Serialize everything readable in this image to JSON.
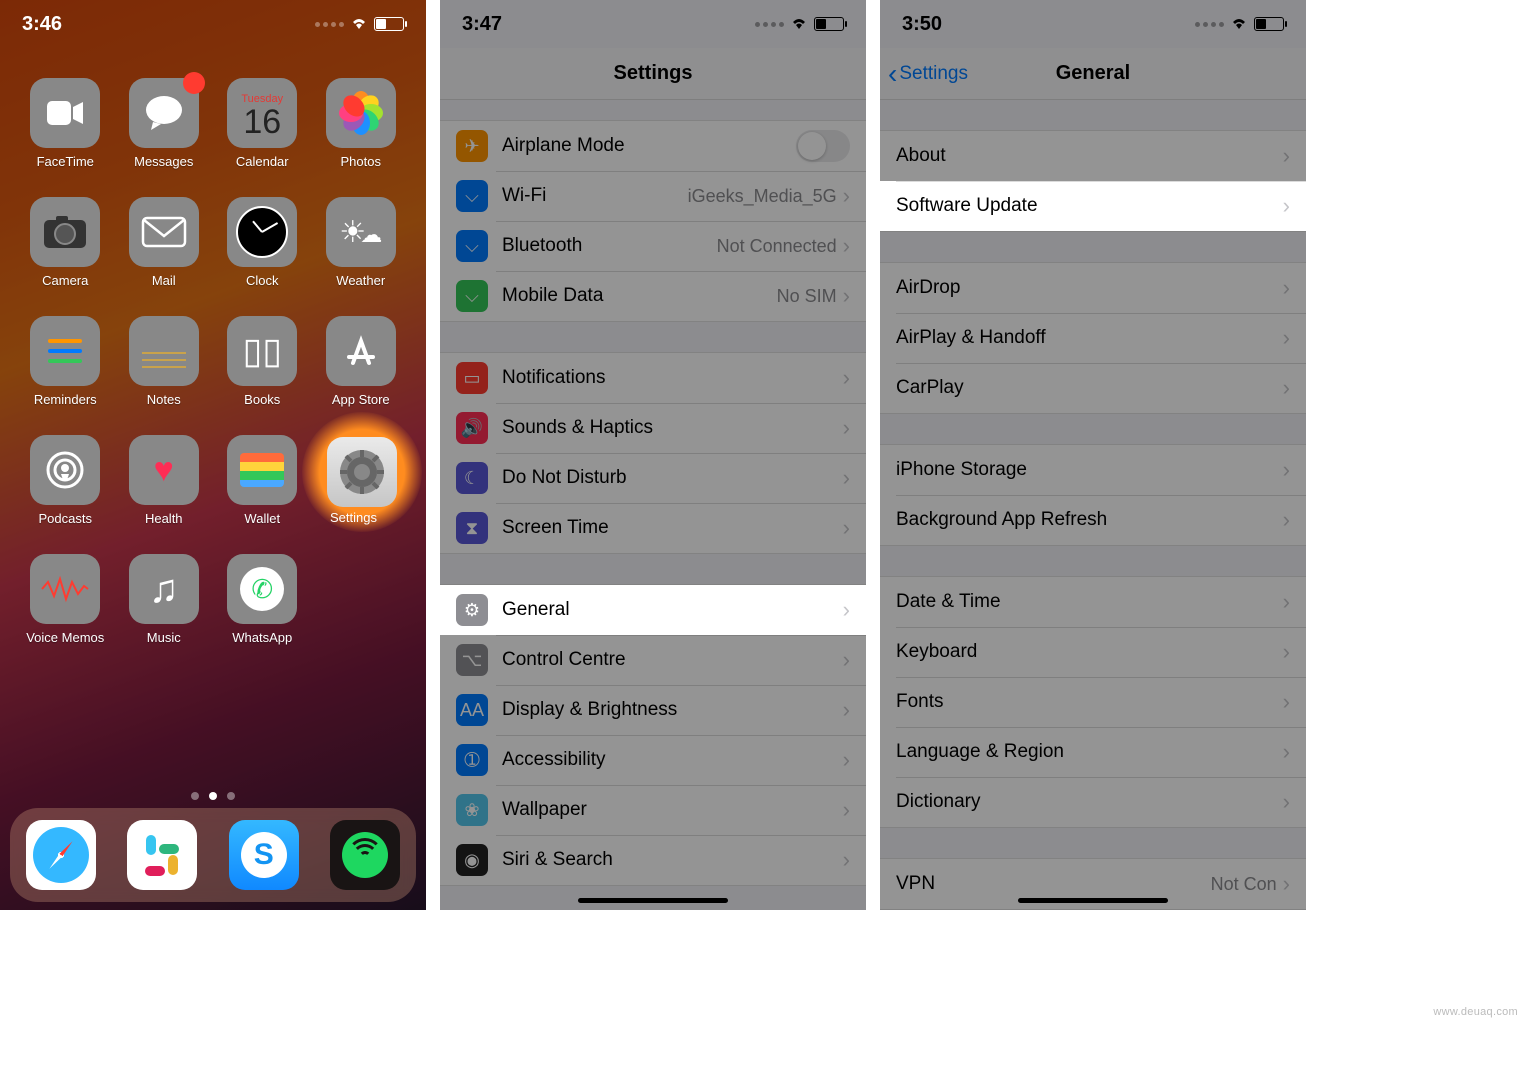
{
  "panel1": {
    "time": "3:46",
    "calendar": {
      "dow": "Tuesday",
      "day": "16"
    },
    "apps_row1": [
      {
        "name": "FaceTime",
        "cls": "t-facetime",
        "glyph": "■"
      },
      {
        "name": "Messages",
        "cls": "t-messages",
        "glyph": "💬",
        "badge": true
      },
      {
        "name": "Calendar",
        "cls": "t-calendar"
      },
      {
        "name": "Photos",
        "cls": "t-photos"
      }
    ],
    "apps_row2": [
      {
        "name": "Camera",
        "cls": "t-camera",
        "glyph": "📷"
      },
      {
        "name": "Mail",
        "cls": "t-mail",
        "glyph": "✉︎"
      },
      {
        "name": "Clock",
        "cls": "t-clock"
      },
      {
        "name": "Weather",
        "cls": "t-weather",
        "glyph": ""
      }
    ],
    "apps_row3": [
      {
        "name": "Reminders",
        "cls": "t-reminders"
      },
      {
        "name": "Notes",
        "cls": "t-notes",
        "glyph": ""
      },
      {
        "name": "Books",
        "cls": "t-books",
        "glyph": "📖"
      },
      {
        "name": "App Store",
        "cls": "t-appstore",
        "glyph": "A"
      }
    ],
    "apps_row4": [
      {
        "name": "Podcasts",
        "cls": "t-podcasts",
        "glyph": "◉"
      },
      {
        "name": "Health",
        "cls": "t-health",
        "glyph": "♥"
      },
      {
        "name": "Wallet",
        "cls": "t-wallet",
        "glyph": ""
      },
      {
        "name": "Settings",
        "cls": "t-settings"
      }
    ],
    "apps_row5": [
      {
        "name": "Voice Memos",
        "cls": "t-voice",
        "glyph": ""
      },
      {
        "name": "Music",
        "cls": "t-music",
        "glyph": "♪"
      },
      {
        "name": "WhatsApp",
        "cls": "t-whatsapp"
      }
    ],
    "dock": [
      "Safari",
      "Slack",
      "Shazam",
      "Spotify"
    ]
  },
  "panel2": {
    "time": "3:47",
    "title": "Settings",
    "g1": [
      {
        "label": "Airplane Mode",
        "ic": "ic-plane",
        "glyph": "✈",
        "toggle": true
      },
      {
        "label": "Wi-Fi",
        "ic": "ic-wifi",
        "glyph": "⌵",
        "val": "iGeeks_Media_5G"
      },
      {
        "label": "Bluetooth",
        "ic": "ic-bt",
        "glyph": "⌵",
        "val": "Not Connected"
      },
      {
        "label": "Mobile Data",
        "ic": "ic-cell",
        "glyph": "⌵",
        "val": "No SIM"
      }
    ],
    "g2": [
      {
        "label": "Notifications",
        "ic": "ic-notif",
        "glyph": "▭"
      },
      {
        "label": "Sounds & Haptics",
        "ic": "ic-sound",
        "glyph": "🔊"
      },
      {
        "label": "Do Not Disturb",
        "ic": "ic-dnd",
        "glyph": "☾"
      },
      {
        "label": "Screen Time",
        "ic": "ic-screen",
        "glyph": "⧗"
      }
    ],
    "g3": [
      {
        "label": "General",
        "ic": "ic-gen",
        "glyph": "⚙",
        "cut": true
      },
      {
        "label": "Control Centre",
        "ic": "ic-cc",
        "glyph": "⌥"
      },
      {
        "label": "Display & Brightness",
        "ic": "ic-disp",
        "glyph": "AA"
      },
      {
        "label": "Accessibility",
        "ic": "ic-acc",
        "glyph": "➀"
      },
      {
        "label": "Wallpaper",
        "ic": "ic-wall",
        "glyph": "❀"
      },
      {
        "label": "Siri & Search",
        "ic": "ic-siri",
        "glyph": "◉"
      }
    ]
  },
  "panel3": {
    "time": "3:50",
    "back": "Settings",
    "title": "General",
    "g1": [
      {
        "label": "About"
      },
      {
        "label": "Software Update",
        "cut": true
      }
    ],
    "g2": [
      {
        "label": "AirDrop"
      },
      {
        "label": "AirPlay & Handoff"
      },
      {
        "label": "CarPlay"
      }
    ],
    "g3": [
      {
        "label": "iPhone Storage"
      },
      {
        "label": "Background App Refresh"
      }
    ],
    "g4": [
      {
        "label": "Date & Time"
      },
      {
        "label": "Keyboard"
      },
      {
        "label": "Fonts"
      },
      {
        "label": "Language & Region"
      },
      {
        "label": "Dictionary"
      }
    ],
    "g5": [
      {
        "label": "VPN",
        "val": "Not Con"
      }
    ]
  },
  "watermark": "www.deuaq.com"
}
